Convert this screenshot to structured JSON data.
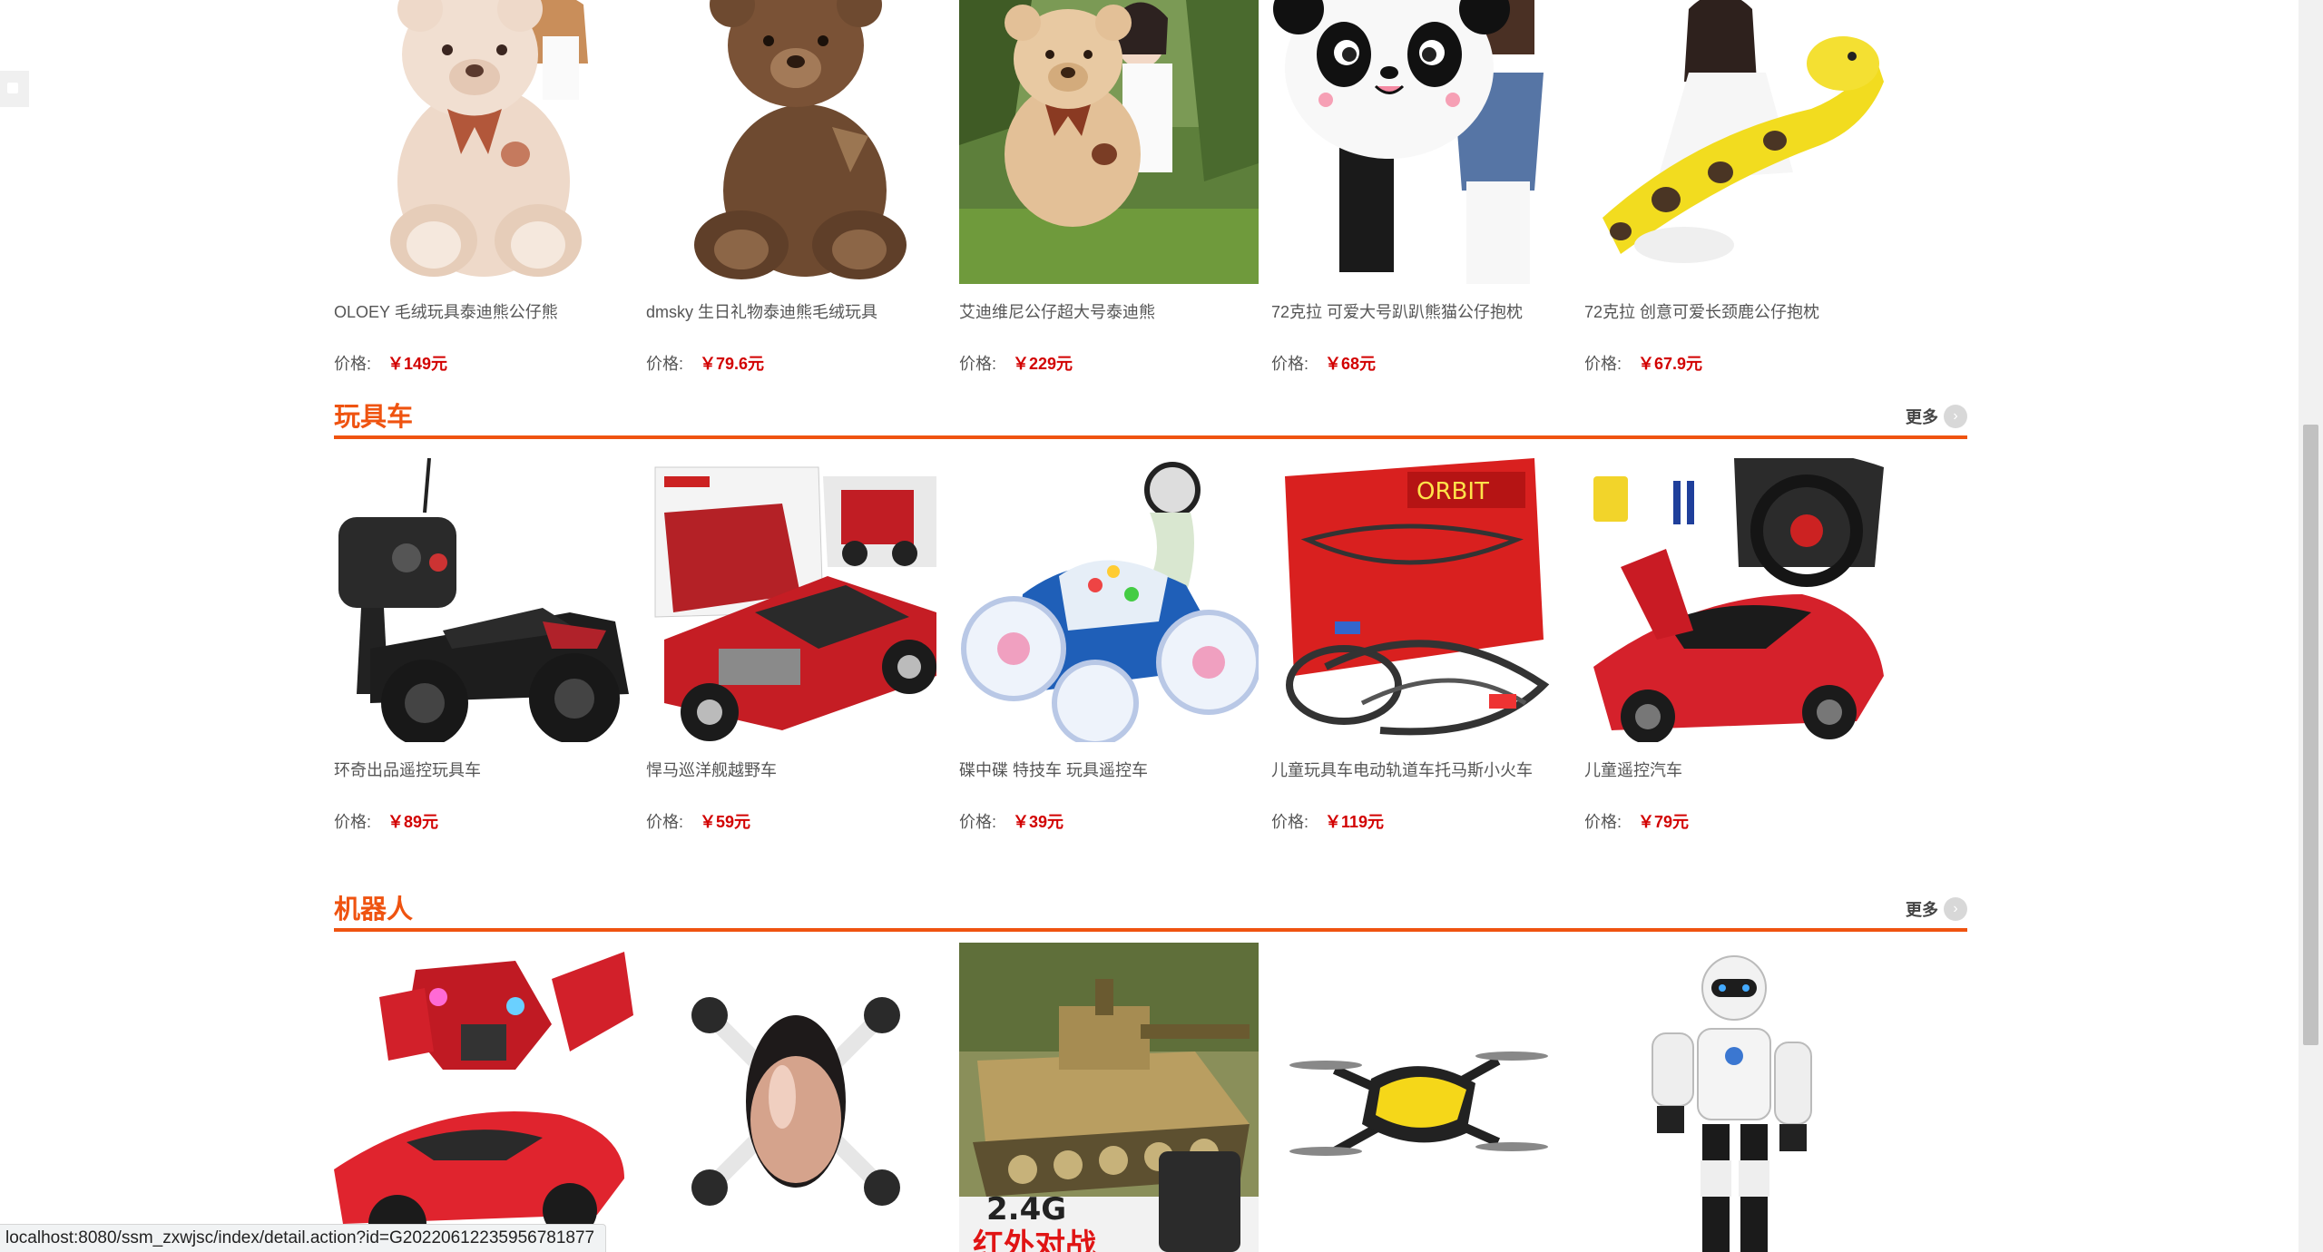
{
  "sections": [
    {
      "title": "",
      "products": [
        {
          "name": "OLOEY 毛绒玩具泰迪熊公仔熊",
          "price_label": "价格:",
          "price": "￥149元",
          "image": "beige-teddy-bear"
        },
        {
          "name": "dmsky 生日礼物泰迪熊毛绒玩具",
          "price_label": "价格:",
          "price": "￥79.6元",
          "image": "brown-teddy-bear"
        },
        {
          "name": "艾迪维尼公仔超大号泰迪熊",
          "price_label": "价格:",
          "price": "￥229元",
          "image": "tan-teddy-bear-outdoor"
        },
        {
          "name": "72克拉 可爱大号趴趴熊猫公仔抱枕",
          "price_label": "价格:",
          "price": "￥68元",
          "image": "panda-plush"
        },
        {
          "name": "72克拉 创意可爱长颈鹿公仔抱枕",
          "price_label": "价格:",
          "price": "￥67.9元",
          "image": "giraffe-plush"
        }
      ]
    },
    {
      "title": "玩具车",
      "more_label": "更多",
      "products": [
        {
          "name": "环奇出品遥控玩具车",
          "price_label": "价格:",
          "price": "￥89元",
          "image": "rc-monster-truck"
        },
        {
          "name": "悍马巡洋舰越野车",
          "price_label": "价格:",
          "price": "￥59元",
          "image": "red-lego-truck"
        },
        {
          "name": "碟中碟 特技车 玩具遥控车",
          "price_label": "价格:",
          "price": "￥39元",
          "image": "stunt-car"
        },
        {
          "name": "儿童玩具车电动轨道车托马斯小火车",
          "price_label": "价格:",
          "price": "￥119元",
          "image": "track-set-box"
        },
        {
          "name": "儿童遥控汽车",
          "price_label": "价格:",
          "price": "￥79元",
          "image": "red-sports-car"
        }
      ]
    },
    {
      "title": "机器人",
      "more_label": "更多",
      "products": [
        {
          "image": "transforming-robot-car"
        },
        {
          "image": "egg-drone"
        },
        {
          "image": "rc-tank",
          "caption_line1": "2.4G",
          "caption_line2": "红外对战"
        },
        {
          "image": "yellow-drone"
        },
        {
          "image": "humanoid-robot"
        }
      ]
    }
  ],
  "status_url": "localhost:8080/ssm_zxwjsc/index/detail.action?id=G20220612235956781877",
  "colors": {
    "accent": "#ef5310",
    "price": "#d20000"
  }
}
